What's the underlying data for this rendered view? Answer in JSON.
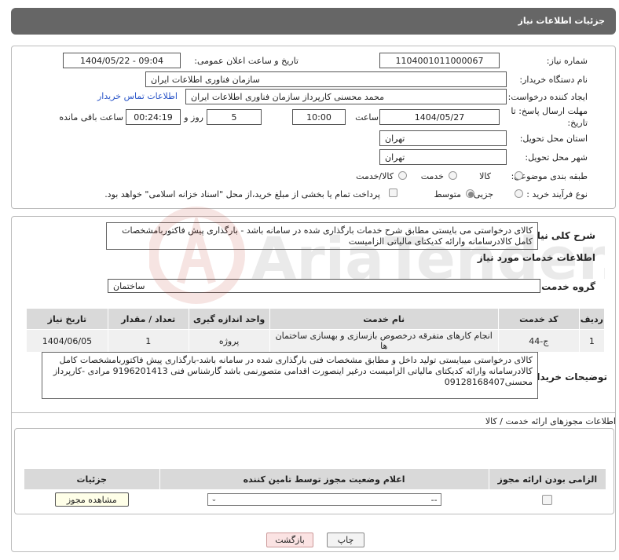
{
  "header": {
    "title": "جزئیات اطلاعات نیاز"
  },
  "form": {
    "need_number_label": "شماره نیاز:",
    "need_number": "1104001011000067",
    "announce_label": "تاریخ و ساعت اعلان عمومی:",
    "announce_value": "1404/05/22 - 09:04",
    "buyer_org_label": "نام دستگاه خریدار:",
    "buyer_org": "سازمان فناوری اطلاعات ایران",
    "creator_label": "ایجاد کننده درخواست:",
    "creator": "محمد محسنی کارپرداز سازمان فناوری اطلاعات ایران",
    "contact_link": "اطلاعات تماس خریدار",
    "deadline_label_1": "مهلت ارسال پاسخ: تا",
    "deadline_label_2": "تاریخ:",
    "deadline_date": "1404/05/27",
    "time_label": "ساعت",
    "deadline_time": "10:00",
    "days_value": "5",
    "days_label": "روز و",
    "remaining_time": "00:24:19",
    "remaining_label": "ساعت باقی مانده",
    "province_label": "استان محل تحویل:",
    "province": "تهران",
    "city_label": "شهر محل تحویل:",
    "city": "تهران",
    "category_label": "طبقه بندی موضوعی:",
    "category_options": [
      "کالا",
      "خدمت",
      "کالا/خدمت"
    ],
    "category_selected": "خدمت",
    "purchase_type_label": "نوع فرآیند خرید :",
    "purchase_options": [
      "جزیی",
      "متوسط"
    ],
    "purchase_selected": "متوسط",
    "payment_note": "پرداخت تمام یا بخشی از مبلغ خرید،از محل \"اسناد خزانه اسلامی\" خواهد بود."
  },
  "summary": {
    "label": "شرح کلی نیاز:",
    "text": "کالای درخواستی می بایستی مطابق شرح خدمات بارگذاری شده در سامانه باشد - بارگذاری پیش فاکتوربامشخصات کامل کالادرسامانه وارائه کدیکتای مالیاتی الزامیست"
  },
  "services": {
    "section_title": "اطلاعات خدمات مورد نیاز",
    "group_label": "گروه خدمت:",
    "group_value": "ساختمان",
    "columns": [
      "ردیف",
      "کد خدمت",
      "نام خدمت",
      "واحد اندازه گیری",
      "تعداد / مقدار",
      "تاریخ نیاز"
    ],
    "rows": [
      [
        "1",
        "ج-44",
        "انجام کارهای متفرقه درخصوص بازسازی و بهسازی ساختمان ها",
        "پروژه",
        "1",
        "1404/06/05"
      ]
    ]
  },
  "buyer_notes": {
    "label": "توضیحات خریدار:",
    "text": "کالای درخواستی میبایستی تولید داخل و مطابق مشخصات فنی بارگذاری شده در سامانه باشد-بارگذاری پیش فاکتوربامشخصات کامل کالادرسامانه وارائه کدیکتای مالیاتی الزامیست درغیر اینصورت اقدامی متصورنمی باشد گارشناس فنی 9196201413 مرادی -کارپرداز محسنی09128168407"
  },
  "permits": {
    "section_title": "اطلاعات مجوزهای ارائه خدمت / کالا",
    "columns": [
      "الزامی بودن ارائه مجوز",
      "اعلام وضعیت مجوز توسط تامین کننده",
      "جزئیات"
    ],
    "select_value": "--",
    "view_button": "مشاهده مجوز"
  },
  "footer": {
    "print_button": "چاپ",
    "back_button": "بازگشت"
  },
  "watermark": {
    "text": "AriaTender.neT"
  }
}
